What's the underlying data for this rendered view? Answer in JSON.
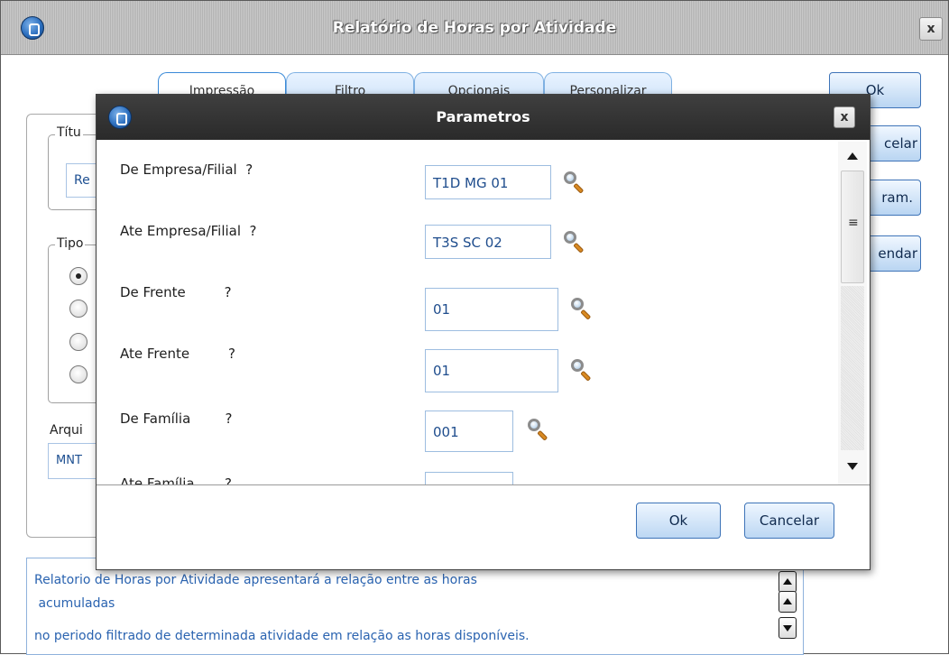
{
  "main_window": {
    "title": "Relatório de Horas por Atividade",
    "close_label": "x",
    "tabs": [
      {
        "label": "Impressão",
        "active": true
      },
      {
        "label": "Filtro",
        "active": false
      },
      {
        "label": "Opcionais",
        "active": false
      },
      {
        "label": "Personalizar",
        "active": false
      }
    ],
    "buttons": {
      "ok": "Ok",
      "cancel_partial": "celar",
      "param_partial": "ram.",
      "schedule_partial": "endar"
    },
    "groups": {
      "title_label_partial": "Títu",
      "title_value_partial": "Re",
      "type_label_partial": "Tipo",
      "file_label_partial": "Arqui",
      "file_value_partial": "MNT"
    },
    "radio_states": [
      true,
      false,
      false,
      false
    ],
    "description": [
      "Relatorio de Horas por Atividade apresentará a relação entre as horas",
      " acumuladas",
      "no periodo filtrado de determinada atividade em relação as horas disponíveis."
    ]
  },
  "param_dialog": {
    "title": "Parametros",
    "close_label": "x",
    "params": [
      {
        "label": "De Empresa/Filial  ?",
        "value": "T1D MG 01"
      },
      {
        "label": "Ate Empresa/Filial  ?",
        "value": "T3S SC 02"
      },
      {
        "label": "De Frente         ?",
        "value": "01"
      },
      {
        "label": "Ate Frente         ?",
        "value": "01"
      },
      {
        "label": "De Família        ?",
        "value": "001"
      },
      {
        "label": "Ate Família       ?",
        "value": ""
      }
    ],
    "scroll_grip": "≡",
    "ok_label": "Ok",
    "cancel_label": "Cancelar"
  },
  "colors": {
    "accent_blue": "#3e74b8",
    "field_text": "#1f4d8d",
    "description_text": "#2a63b0",
    "dialog_titlebar": "#2f2f2f"
  },
  "icons": [
    "app-logo-icon",
    "close-icon",
    "search-icon",
    "scroll-up-icon",
    "scroll-down-icon"
  ]
}
